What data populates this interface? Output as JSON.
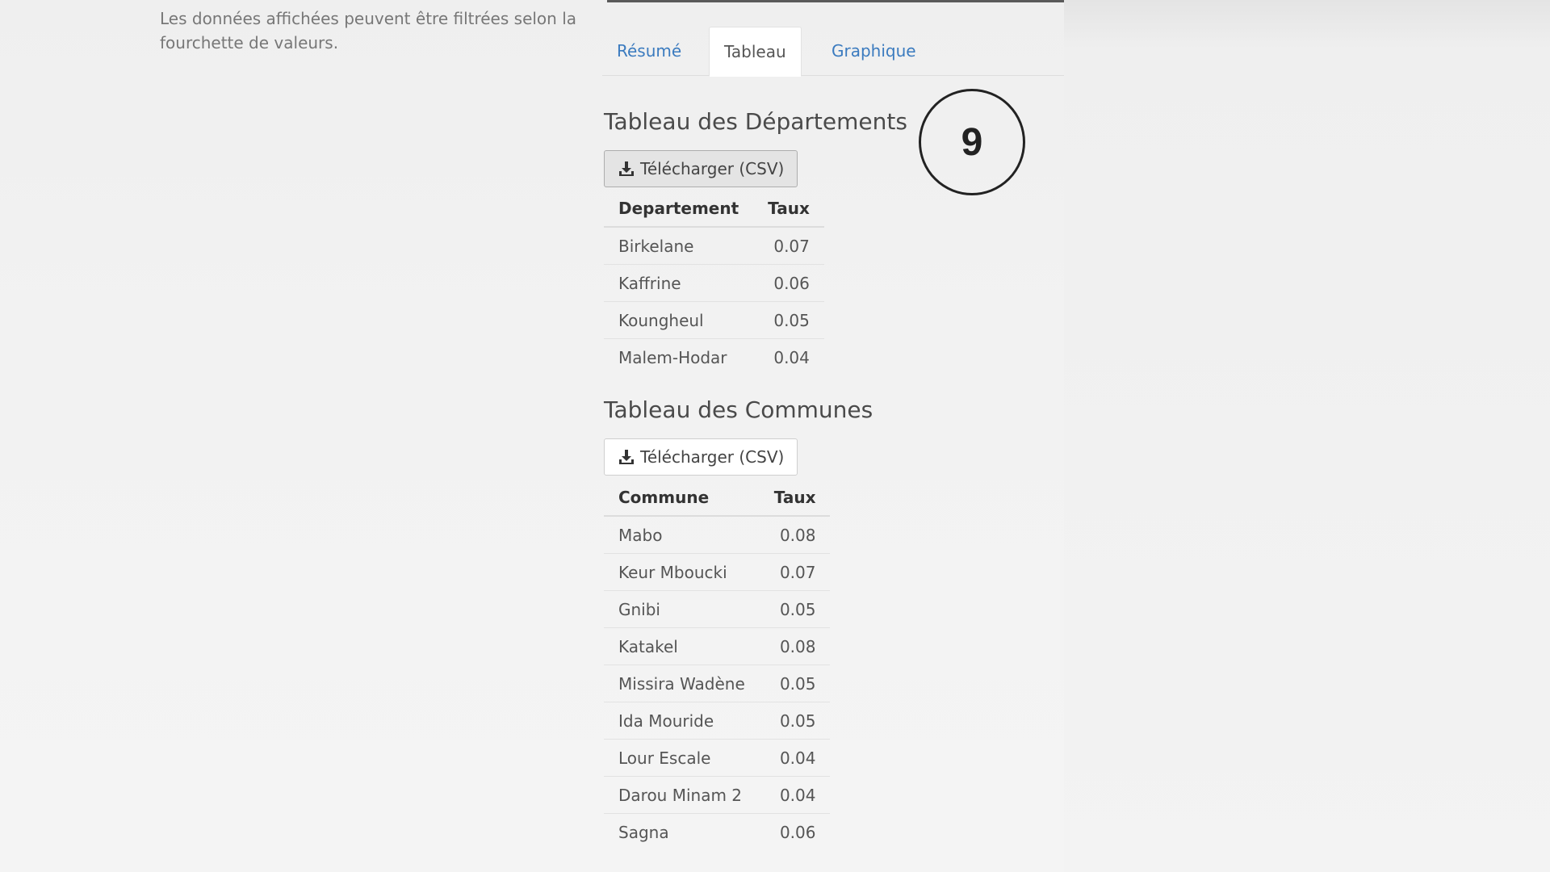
{
  "intro": {
    "line1": "Les données affichées peuvent être filtrées selon la",
    "line2": "fourchette de valeurs."
  },
  "tabs": [
    {
      "label": "Résumé",
      "active": false
    },
    {
      "label": "Tableau",
      "active": true
    },
    {
      "label": "Graphique",
      "active": false
    }
  ],
  "departements": {
    "title": "Tableau des Départements",
    "download_label": "Télécharger (CSV)",
    "columns": [
      "Departement",
      "Taux"
    ],
    "rows": [
      [
        "Birkelane",
        "0.07"
      ],
      [
        "Kaffrine",
        "0.06"
      ],
      [
        "Koungheul",
        "0.05"
      ],
      [
        "Malem-Hodar",
        "0.04"
      ]
    ]
  },
  "communes": {
    "title": "Tableau des Communes",
    "download_label": "Télécharger (CSV)",
    "columns": [
      "Commune",
      "Taux"
    ],
    "rows": [
      [
        "Mabo",
        "0.08"
      ],
      [
        "Keur Mboucki",
        "0.07"
      ],
      [
        "Gnibi",
        "0.05"
      ],
      [
        "Katakel",
        "0.08"
      ],
      [
        "Missira Wadène",
        "0.05"
      ],
      [
        "Ida Mouride",
        "0.05"
      ],
      [
        "Lour Escale",
        "0.04"
      ],
      [
        "Darou Minam 2",
        "0.04"
      ],
      [
        "Sagna",
        "0.06"
      ]
    ]
  },
  "step_badge": {
    "number": "9"
  },
  "icons": {
    "download": "download-icon"
  }
}
